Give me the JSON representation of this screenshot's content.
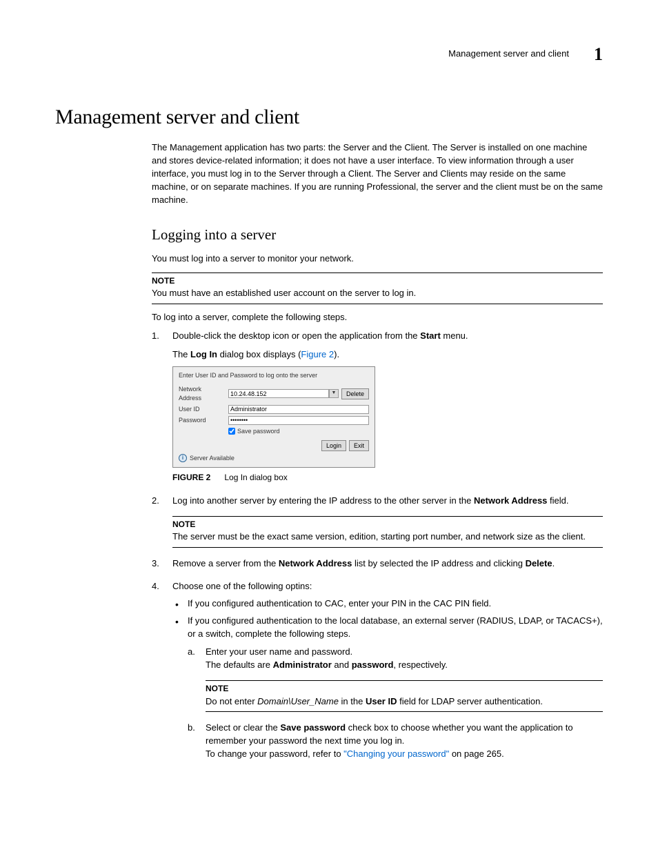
{
  "header": {
    "running_title": "Management server and client",
    "chapter_number": "1"
  },
  "h1": "Management server and client",
  "intro": "The Management application has two parts: the Server and the Client. The Server is installed on one machine and stores device-related information; it does not have a user interface. To view information through a user interface, you must log in to the Server through a Client. The Server and Clients may reside on the same machine, or on separate machines. If you are running Professional, the server and the client must be on the same machine.",
  "section": {
    "h2": "Logging into a server",
    "lead": "You must log into a server to monitor your network.",
    "note1_label": "NOTE",
    "note1_text": "You must have an established user account on the server to log in.",
    "para_steps_intro": "To log into a server, complete the following steps.",
    "step1_a": "Double-click the desktop icon or open the application from the ",
    "step1_bold": "Start",
    "step1_b": " menu.",
    "step1_sub_a": "The ",
    "step1_sub_bold": "Log In",
    "step1_sub_b": " dialog box displays (",
    "step1_sub_link": "Figure 2",
    "step1_sub_c": ").",
    "figure": {
      "label": "FIGURE 2",
      "caption": "Log In dialog box"
    },
    "dialog": {
      "instruction": "Enter User ID and Password to log onto the server",
      "network_label": "Network Address",
      "network_value": "10.24.48.152",
      "delete_btn": "Delete",
      "user_label": "User ID",
      "user_value": "Administrator",
      "pass_label": "Password",
      "pass_value": "••••••••",
      "save_label": "Save password",
      "login_btn": "Login",
      "exit_btn": "Exit",
      "status": "Server Available"
    },
    "step2_a": "Log into another server by entering the IP address to the other server in the ",
    "step2_bold": "Network Address",
    "step2_b": " field.",
    "note2_label": "NOTE",
    "note2_text": "The server must be the exact same version, edition, starting port number, and network size as the client.",
    "step3_a": "Remove a server from the ",
    "step3_bold1": "Network Address",
    "step3_b": " list by selected the IP address and clicking ",
    "step3_bold2": "Delete",
    "step3_c": ".",
    "step4": "Choose one of the following optins:",
    "bullet1": "If you configured authentication to CAC, enter your PIN in the CAC PIN field.",
    "bullet2": "If you configured authentication to the local database, an external server (RADIUS, LDAP, or TACACS+), or a switch, complete the following steps.",
    "sub_a_line1": "Enter your user name and password.",
    "sub_a_line2_a": "The defaults are ",
    "sub_a_bold1": "Administrator",
    "sub_a_line2_b": " and ",
    "sub_a_bold2": "password",
    "sub_a_line2_c": ", respectively.",
    "note3_label": "NOTE",
    "note3_a": "Do not enter ",
    "note3_italic": "Domain\\User_Name",
    "note3_b": " in the ",
    "note3_bold": "User ID",
    "note3_c": " field for LDAP server authentication.",
    "sub_b_line1_a": "Select or clear the ",
    "sub_b_bold": "Save password",
    "sub_b_line1_b": " check box to choose whether you want the application to remember your password the next time you log in.",
    "sub_b_line2_a": "To change your password, refer to ",
    "sub_b_link": "\"Changing your password\"",
    "sub_b_line2_b": " on page 265."
  }
}
